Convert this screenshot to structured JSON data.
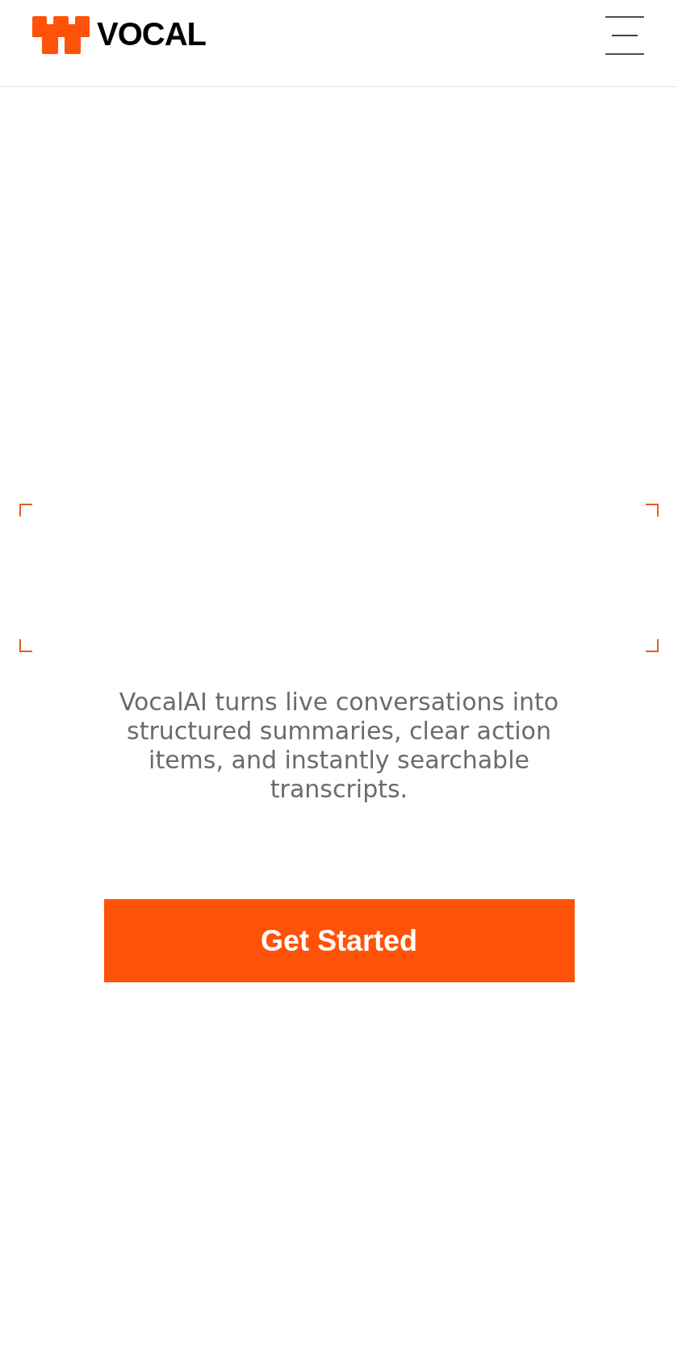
{
  "header": {
    "logo": {
      "text": "VOCAL"
    }
  },
  "hero": {
    "description": "VocalAI turns live conversations into structured summaries, clear action items, and instantly searchable transcripts.",
    "cta": {
      "label": "Get Started"
    }
  }
}
